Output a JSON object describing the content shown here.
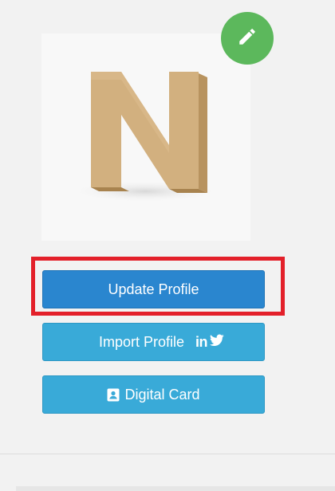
{
  "profile": {
    "image_alt": "N"
  },
  "buttons": {
    "update_profile": "Update Profile",
    "import_profile": "Import Profile",
    "digital_card": "Digital Card"
  },
  "social": {
    "linkedin_text": "in"
  },
  "icons": {
    "edit": "pencil-icon",
    "linkedin": "linkedin-icon",
    "twitter": "twitter-icon",
    "card": "contact-card-icon"
  },
  "colors": {
    "edit_button": "#5cb85c",
    "update_button": "#2a86cf",
    "secondary_button": "#39aad8",
    "highlight": "#e3202a"
  }
}
